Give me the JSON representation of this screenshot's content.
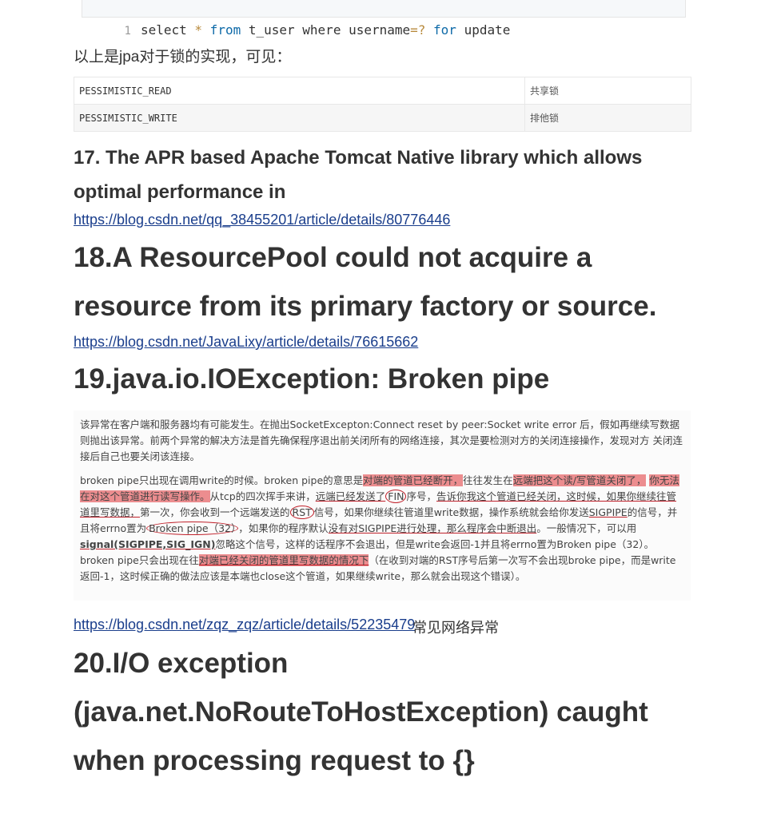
{
  "code": {
    "line_number": "1",
    "tokens": [
      {
        "text": "select ",
        "type": "plain"
      },
      {
        "text": "*",
        "type": "op"
      },
      {
        "text": " from",
        "type": "kw"
      },
      {
        "text": " t_user where username",
        "type": "plain"
      },
      {
        "text": "=?",
        "type": "op"
      },
      {
        "text": " for",
        "type": "kw"
      },
      {
        "text": " update",
        "type": "plain"
      }
    ]
  },
  "intro_paragraph": "以上是jpa对于锁的实现，可见：",
  "lock_table": {
    "rows": [
      {
        "mode": "PESSIMISTIC_READ",
        "meaning": "共享锁"
      },
      {
        "mode": "PESSIMISTIC_WRITE",
        "meaning": "排他锁"
      }
    ]
  },
  "sections": {
    "s17": {
      "heading": "17. The APR based Apache Tomcat Native library which allows optimal performance in",
      "link": "https://blog.csdn.net/qq_38455201/article/details/80776446"
    },
    "s18": {
      "heading": "18.A ResourcePool could not acquire a resource from its primary factory or source.",
      "link": "https://blog.csdn.net/JavaLixy/article/details/76615662"
    },
    "s19": {
      "heading": "19.java.io.IOException: Broken pipe",
      "link": "https://blog.csdn.net/zqz_zqz/article/details/52235479",
      "link_note": "常见网络异常"
    },
    "s20": {
      "heading": "20.I/O exception (java.net.NoRouteToHostException) caught when processing request to {}"
    }
  },
  "figure": {
    "p1": "该异常在客户端和服务器均有可能发生。在抛出SocketExcepton:Connect reset by peer:Socket write error 后，假如再继续写数据则抛出该异常。前两个异常的解决方法是首先确保程序退出前关闭所有的网络连接，其次是要检测对方的关闭连接操作，发现对方 关闭连接后自己也要关闭该连接。",
    "p2": {
      "a": "broken pipe只出现在调用write的时候。broken pipe的意思是",
      "hl1": "对端的管道已经断开，",
      "b": "往往发生在",
      "hl2": "远端把这个读/写管道关闭了，",
      "c": " ",
      "hl3": "你无法在对这个管道进行读写操作。",
      "d": "从tcp的四次挥手来讲，",
      "ul1": "远端已经发送了",
      "fin": "FIN",
      "e": "序号，",
      "ul2": "告诉你我这个管道已经关闭，这时候，如果你继续往管道里写数据，",
      "f": "第一次，你会收到一个远端发送的",
      "rst": "RST",
      "g": "信号，如果你继续往管道里write数据，操作系统就会给你发送",
      "sigpipe": "SIGPIPE",
      "h": "的信号，并且将errno置为",
      "broken": "Broken pipe（32）",
      "i": "，如果你的程序默认",
      "ul3": "没有对SIGPIPE进行处理，那么程序会中断退出",
      "j": "。一般情况下，可以用",
      "signal": "signal(SIGPIPE,SIG_IGN)",
      "k": "忽略这个信号，这样的话程序不会退出，但是write会返回-1并且将errno置为Broken pipe（32）。broken pipe只会出现在往",
      "hl4": "对端已经关闭的管道里写数据的情况下",
      "l": "（在收到对端的RST序号后第一次写不会出现broke pipe，而是write返回-1，这时候正确的做法应该是本端也close这个管道，如果继续write，那么就会出现这个错误）。"
    }
  }
}
